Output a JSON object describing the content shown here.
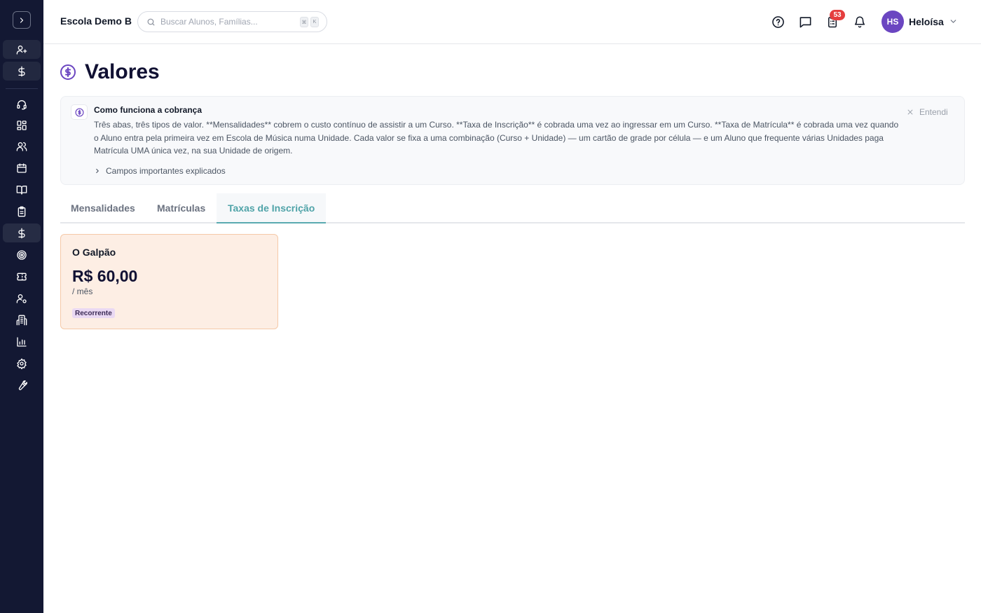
{
  "sidebar": {
    "items": [
      {
        "id": "user-plus",
        "icon": "user-plus-icon"
      },
      {
        "id": "finance-top",
        "icon": "dollar-icon"
      },
      {
        "id": "support",
        "icon": "headset-icon"
      },
      {
        "id": "dashboard",
        "icon": "grid-icon"
      },
      {
        "id": "users",
        "icon": "users-icon"
      },
      {
        "id": "calendar",
        "icon": "calendar-icon"
      },
      {
        "id": "courses",
        "icon": "book-open-icon"
      },
      {
        "id": "clipboard",
        "icon": "clipboard-icon"
      },
      {
        "id": "values",
        "icon": "dollar-icon"
      },
      {
        "id": "target",
        "icon": "target-icon"
      },
      {
        "id": "tickets",
        "icon": "ticket-icon"
      },
      {
        "id": "user-settings",
        "icon": "user-cog-icon"
      },
      {
        "id": "buildings",
        "icon": "building-icon"
      },
      {
        "id": "reports",
        "icon": "bar-chart-icon"
      },
      {
        "id": "settings",
        "icon": "gear-icon"
      },
      {
        "id": "tools",
        "icon": "wrench-icon"
      }
    ]
  },
  "header": {
    "school_name": "Escola Demo B",
    "search_placeholder": "Buscar Alunos, Famílias...",
    "shortcut_keys": [
      "⌘",
      "K"
    ],
    "notifications_count": "53",
    "user_initials": "HS",
    "user_name": "Heloísa"
  },
  "page": {
    "title": "Valores"
  },
  "info": {
    "title": "Como funciona a cobrança",
    "text": "Três abas, três tipos de valor. **Mensalidades** cobrem o custo contínuo de assistir a um Curso. **Taxa de Inscrição** é cobrada uma vez ao ingressar em um Curso. **Taxa de Matrícula** é cobrada uma vez quando o Aluno entra pela primeira vez em Escola de Música numa Unidade. Cada valor se fixa a uma combinação (Curso + Unidade) — um cartão de grade por célula — e um Aluno que frequente várias Unidades paga Matrícula UMA única vez, na sua Unidade de origem.",
    "expand_label": "Campos importantes explicados",
    "dismiss_label": "Entendi"
  },
  "tabs": [
    {
      "label": "Mensalidades",
      "active": false
    },
    {
      "label": "Matrículas",
      "active": false
    },
    {
      "label": "Taxas de Inscrição",
      "active": true
    }
  ],
  "cards": [
    {
      "title": "O Galpão",
      "price": "R$ 60,00",
      "period": "/ mês",
      "tag": "Recorrente"
    }
  ],
  "colors": {
    "sidebar_bg": "#131833",
    "accent_teal": "#4fa3a8",
    "accent_purple": "#6b46c1",
    "badge_red": "#e53e3e",
    "card_bg": "#fdeee4"
  }
}
